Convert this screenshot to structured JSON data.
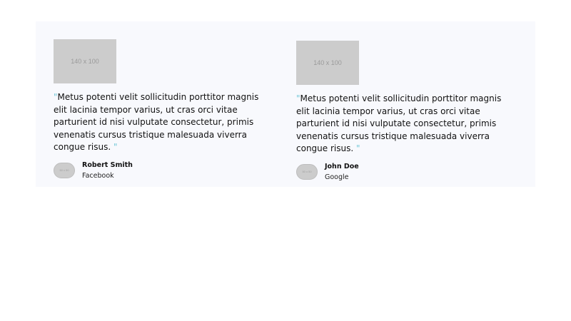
{
  "testimonials": [
    {
      "logo_text": "140 x 100",
      "quote_open": "\"",
      "quote": "Metus potenti velit sollicitudin porttitor magnis elit lacinia tempor varius, ut cras orci vitae parturient id nisi vulputate consectetur, primis venenatis cursus tristique malesuada viverra congue risus.",
      "quote_close": "\"",
      "avatar_text": "50 x 50",
      "author_name": "Robert Smith",
      "author_company": "Facebook"
    },
    {
      "logo_text": "140 x 100",
      "quote_open": "\"",
      "quote": "Metus potenti velit sollicitudin porttitor magnis elit lacinia tempor varius, ut cras orci vitae parturient id nisi vulputate consectetur, primis venenatis cursus tristique malesuada viverra congue risus.",
      "quote_close": "\"",
      "avatar_text": "50 x 50",
      "author_name": "John Doe",
      "author_company": "Google"
    }
  ],
  "colors": {
    "section_background": "#f8f9fd",
    "placeholder": "#cccccc",
    "quote_mark": "#6ec6d6",
    "text": "#111111"
  }
}
